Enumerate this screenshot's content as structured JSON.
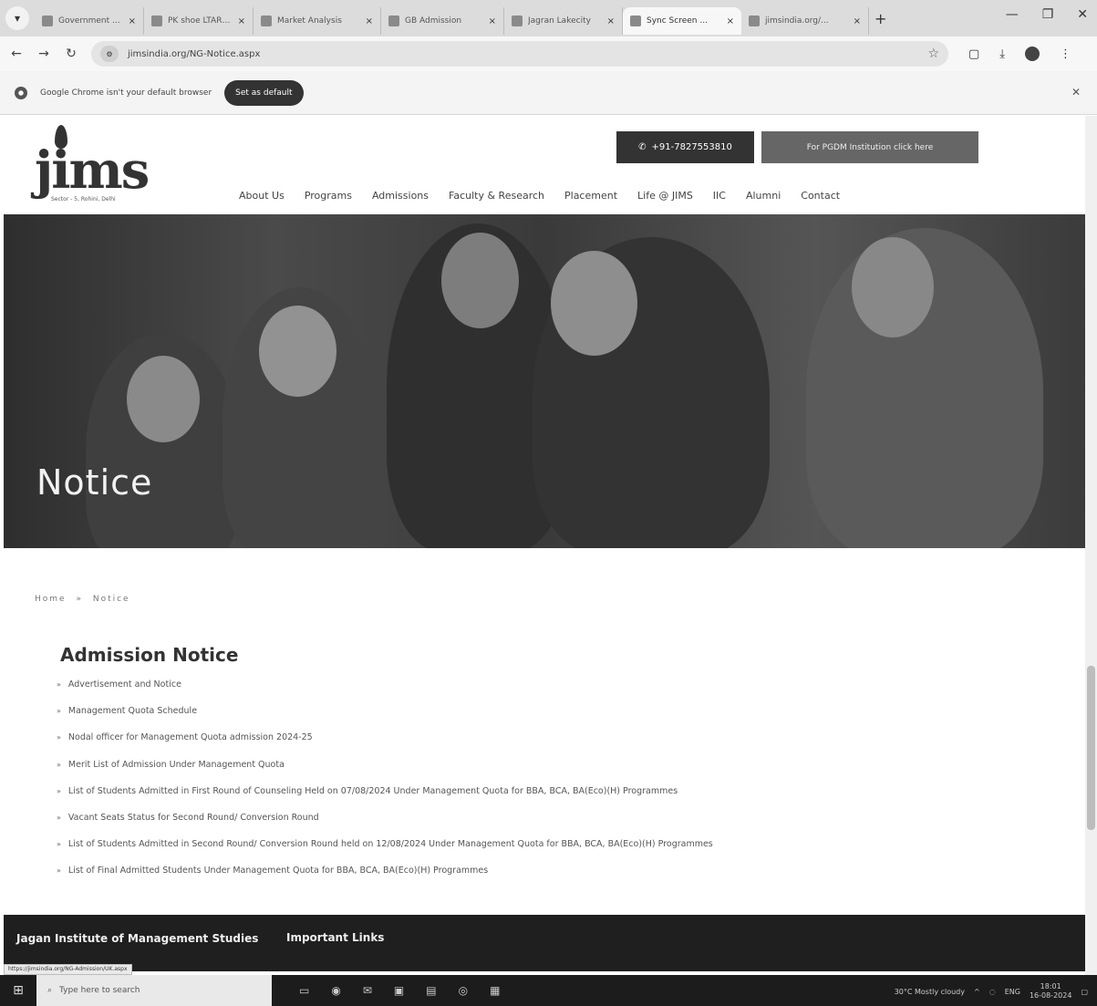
{
  "browser": {
    "tabs": [
      {
        "label": "Government ...",
        "active": false
      },
      {
        "label": "PK shoe LTAR ...",
        "active": false
      },
      {
        "label": "Market Analysis",
        "active": false
      },
      {
        "label": "GB Admission",
        "active": false
      },
      {
        "label": "Jagran Lakecity",
        "active": false
      },
      {
        "label": "Sync Screen ...",
        "active": true
      },
      {
        "label": "jimsindia.org/...",
        "active": false
      }
    ],
    "url": "jimsindia.org/NG-Notice.aspx",
    "infobar_text": "Google Chrome isn't your default browser",
    "set_default_label": "Set as default"
  },
  "site": {
    "logo_text": "jims",
    "logo_tagline": "Sector - 5, Rohini, Delhi",
    "phone_label": "+91-7827553810",
    "pgdm_label": "For PGDM Institution click here",
    "nav": [
      "About Us",
      "Programs",
      "Admissions",
      "Faculty & Research",
      "Placement",
      "Life @ JIMS",
      "IIC",
      "Alumni",
      "Contact"
    ]
  },
  "hero": {
    "title": "Notice"
  },
  "breadcrumb": {
    "home": "Home",
    "sep": "»",
    "current": "Notice"
  },
  "content": {
    "section_title": "Admission Notice",
    "notices": [
      "Advertisement and Notice",
      "Management Quota Schedule",
      "Nodal officer for Management Quota admission 2024-25",
      "Merit List of Admission Under Management Quota",
      "List of Students Admitted in First Round of Counseling Held on 07/08/2024 Under Management Quota for BBA, BCA, BA(Eco)(H) Programmes",
      "Vacant Seats Status for Second Round/ Conversion Round",
      "List of Students Admitted in Second Round/ Conversion Round held on 12/08/2024 Under Management Quota for BBA, BCA, BA(Eco)(H) Programmes",
      "List of Final Admitted Students Under Management Quota for BBA, BCA, BA(Eco)(H) Programmes"
    ]
  },
  "footer": {
    "institute_name": "Jagan Institute of Management Studies",
    "important_links": "Important Links"
  },
  "status_url": "https://jimsindia.org/NG-Admission/UK.aspx",
  "taskbar": {
    "search_placeholder": "Type here to search",
    "weather": "30°C  Mostly cloudy",
    "lang": "ENG",
    "time": "18:01",
    "date": "16-08-2024"
  }
}
